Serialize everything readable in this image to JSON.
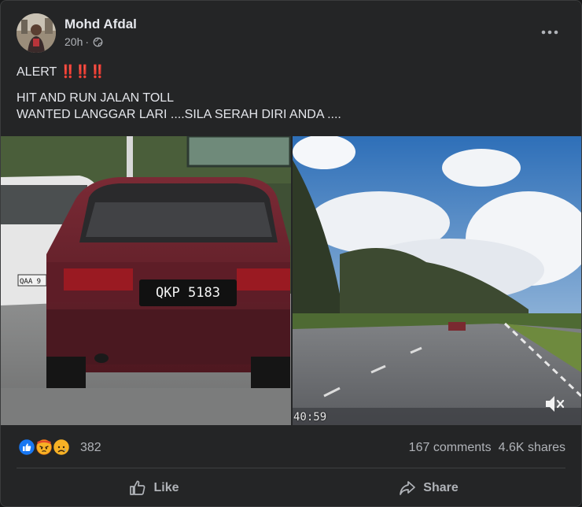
{
  "post": {
    "author": "Mohd Afdal",
    "time": "20h",
    "privacy_icon": "globe-icon",
    "text": {
      "headline": "ALERT",
      "emoji": "‼️‼️‼️",
      "line2": "HIT AND RUN JALAN TOLL",
      "line3": "WANTED LANGGAR LARI ....SILA SERAH DIRI ANDA ...."
    },
    "image_left": {
      "plate": "QKP 5183",
      "plate_partial": "QAA 9"
    },
    "video_right": {
      "timestamp": "40:59",
      "mute_icon": "volume-muted-icon"
    }
  },
  "engagement": {
    "reaction_icons": [
      "like-icon",
      "angry-icon",
      "sad-icon"
    ],
    "reaction_count": "382",
    "comments": "167 comments",
    "shares": "4.6K shares"
  },
  "actions": {
    "like_label": "Like",
    "share_label": "Share"
  },
  "colors": {
    "card": "#242526",
    "text": "#e4e6eb",
    "secondary": "#b0b3b8",
    "like_blue": "#1877f2"
  }
}
